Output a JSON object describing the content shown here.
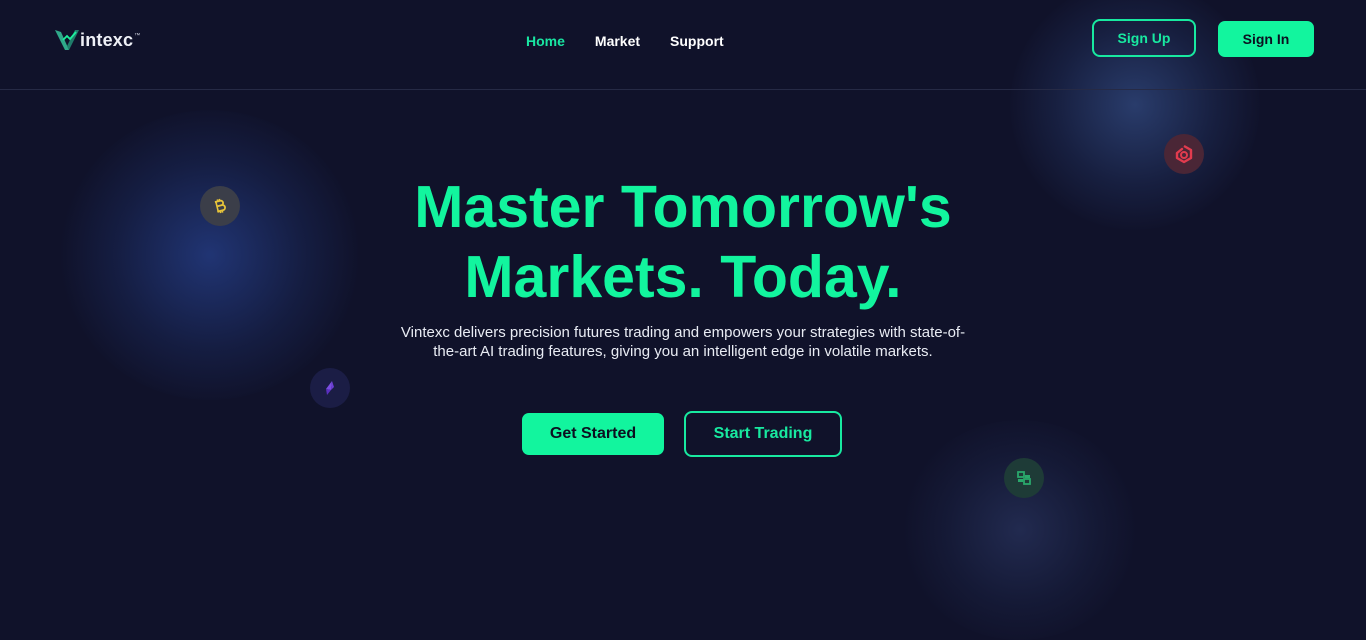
{
  "brand": {
    "name": "intexc",
    "mark": "V",
    "tm": "™"
  },
  "nav": {
    "items": [
      {
        "label": "Home",
        "active": true
      },
      {
        "label": "Market",
        "active": false
      },
      {
        "label": "Support",
        "active": false
      }
    ]
  },
  "auth": {
    "signup_label": "Sign Up",
    "signin_label": "Sign In"
  },
  "hero": {
    "title_line1": "Master Tomorrow's",
    "title_line2": "Markets. Today.",
    "description": "Vintexc delivers precision futures trading and empowers your strategies with state-of-the-art AI trading features, giving you an intelligent edge in volatile markets.",
    "primary_cta": "Get Started",
    "secondary_cta": "Start Trading"
  },
  "coins": [
    {
      "icon": "bitcoin-icon",
      "color": "#e7c43a"
    },
    {
      "icon": "ethereum-icon",
      "color": "#6b3fd0"
    },
    {
      "icon": "red-token-icon",
      "color": "#e23b4e"
    },
    {
      "icon": "bnb-icon",
      "color": "#2aa86b"
    }
  ],
  "colors": {
    "accent": "#12f59e",
    "background": "#10122a",
    "text": "#ffffff"
  }
}
